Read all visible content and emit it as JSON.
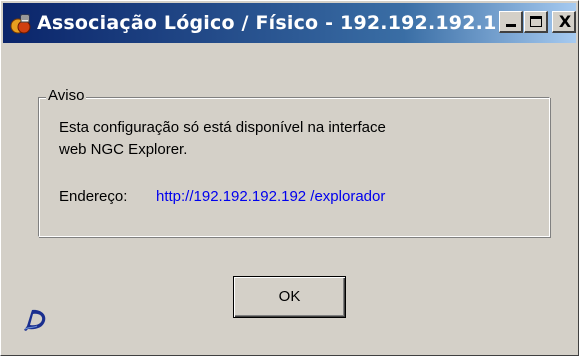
{
  "window": {
    "title": "Associação Lógico / Físico - 192.192.192.1",
    "icon": "app-icon",
    "controls": {
      "minimize_icon": "minimize-icon",
      "maximize_icon": "maximize-icon",
      "close_glyph": "X"
    }
  },
  "notice": {
    "group_label": "Aviso",
    "message_line1": "Esta configuração só está disponível na interface",
    "message_line2": "web NGC Explorer.",
    "address_label": "Endereço:",
    "address_link": "http://192.192.192.192 /explorador"
  },
  "actions": {
    "ok_label": "OK"
  },
  "colors": {
    "window_bg": "#d4d0c8",
    "titlebar_start": "#0a246a",
    "titlebar_end": "#a6caf0",
    "link": "#0000ee",
    "logo": "#1a2f8f"
  }
}
